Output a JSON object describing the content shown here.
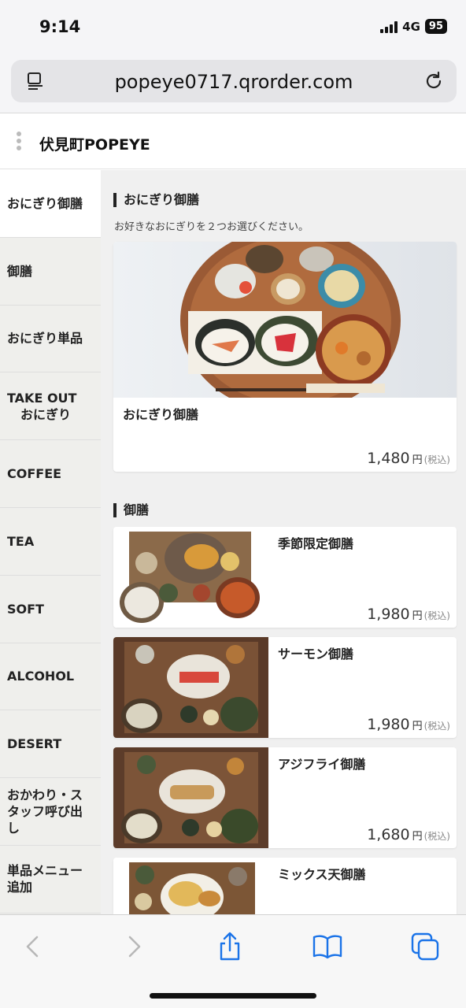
{
  "status": {
    "time": "9:14",
    "network": "4G",
    "battery": "95"
  },
  "browser": {
    "url": "popeye0717.qrorder.com"
  },
  "site": {
    "name": "伏見町POPEYE"
  },
  "sidebar": {
    "items": [
      {
        "line1": "おにぎり御膳",
        "line2": ""
      },
      {
        "line1": "御膳",
        "line2": ""
      },
      {
        "line1": "おにぎり単品",
        "line2": ""
      },
      {
        "line1": "TAKE OUT",
        "line2": "おにぎり"
      },
      {
        "line1": "COFFEE",
        "line2": ""
      },
      {
        "line1": "TEA",
        "line2": ""
      },
      {
        "line1": "SOFT",
        "line2": ""
      },
      {
        "line1": "ALCOHOL",
        "line2": ""
      },
      {
        "line1": "DESERT",
        "line2": ""
      },
      {
        "line1": "おかわり・ス",
        "line2": "タッフ呼び出",
        "line3": "し"
      },
      {
        "line1": "単品メニュー",
        "line2": "追加"
      }
    ]
  },
  "sections": {
    "onigiri": {
      "title": "おにぎり御膳",
      "description": "お好きなおにぎりを２つお選びください。",
      "item": {
        "name": "おにぎり御膳",
        "price": "1,480",
        "currency": "円",
        "tax": "(税込)"
      }
    },
    "gozen": {
      "title": "御膳",
      "items": [
        {
          "name": "季節限定御膳",
          "price": "1,980",
          "currency": "円",
          "tax": "(税込)"
        },
        {
          "name": "サーモン御膳",
          "price": "1,980",
          "currency": "円",
          "tax": "(税込)"
        },
        {
          "name": "アジフライ御膳",
          "price": "1,680",
          "currency": "円",
          "tax": "(税込)"
        },
        {
          "name": "ミックス天御膳",
          "price": "",
          "currency": "",
          "tax": ""
        }
      ]
    }
  },
  "toolbar": {
    "icons": [
      "back-icon",
      "forward-icon",
      "share-icon",
      "bookmarks-icon",
      "tabs-icon"
    ]
  }
}
